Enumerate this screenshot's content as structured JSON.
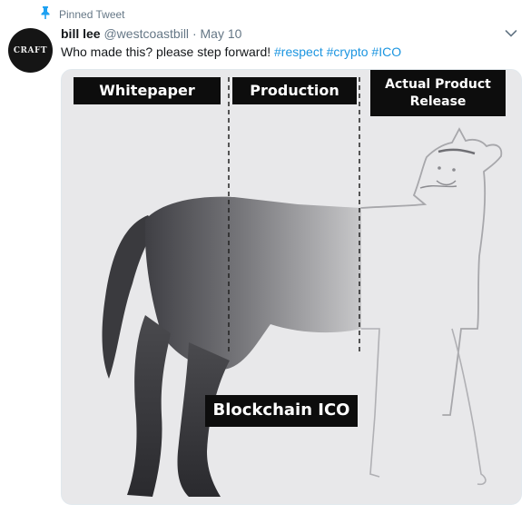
{
  "pinned": {
    "label": "Pinned Tweet",
    "icon": "pin-icon"
  },
  "avatar": {
    "text": "CRAFT",
    "background": "#151515"
  },
  "tweet": {
    "name": "bill lee",
    "handle": "@westcoastbill",
    "separator": "·",
    "date": "May 10",
    "text": "Who made this?  please step forward! ",
    "hashtags": [
      "#respect",
      "#crypto",
      "#ICO"
    ],
    "link_color": "#1b95e0"
  },
  "media": {
    "labels": {
      "whitepaper": "Whitepaper",
      "production": "Production",
      "actual": "Actual Product\nRelease",
      "blockchain": "Blockchain ICO"
    }
  },
  "icons": {
    "menu": "chevron-down-icon"
  }
}
